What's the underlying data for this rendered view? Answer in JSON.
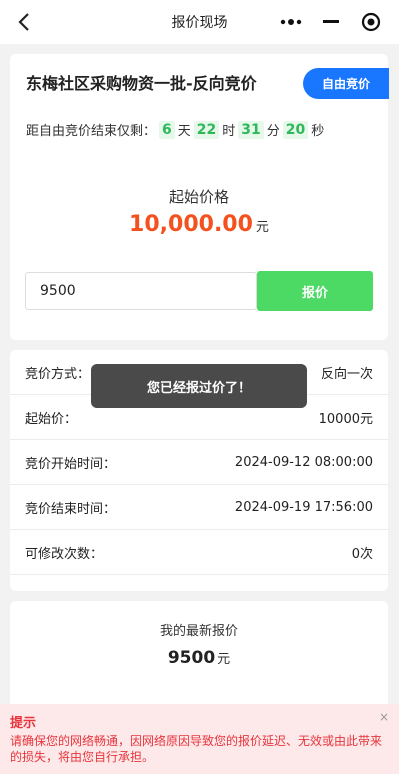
{
  "nav": {
    "title": "报价现场",
    "back_icon": "chevron-left-icon",
    "more_icon": "more-dots-icon",
    "minimize_icon": "minus-icon",
    "close_icon": "target-circle-icon"
  },
  "auction": {
    "title": "东梅社区采购物资一批-反向竞价",
    "tag": "自由竞价",
    "countdown_prefix": "距自由竞价结束仅剩：",
    "days": "6",
    "days_unit": "天",
    "hours": "22",
    "hours_unit": "时",
    "minutes": "31",
    "minutes_unit": "分",
    "seconds": "20",
    "seconds_unit": "秒",
    "start_price_label": "起始价格",
    "start_price_value": "10,000.00",
    "start_price_unit": "元",
    "bid_input_value": "9500",
    "bid_button": "报价"
  },
  "details": [
    {
      "label": "竞价方式：",
      "value": "反向一次"
    },
    {
      "label": "起始价：",
      "value": "10000元"
    },
    {
      "label": "竞价开始时间：",
      "value": "2024-09-12 08:00:00"
    },
    {
      "label": "竞价结束时间：",
      "value": "2024-09-19 17:56:00"
    },
    {
      "label": "可修改次数：",
      "value": "0次"
    }
  ],
  "mine": {
    "label": "我的最新报价",
    "value": "9500",
    "unit": "元"
  },
  "toast": "您已经报过价了！",
  "notice": {
    "title": "提示",
    "text": "请确保您的网络畅通，因网络原因导致您的报价延迟、无效或由此带来的损失，将由您自行承担。",
    "close": "×"
  },
  "colors": {
    "accent_blue": "#1976ff",
    "green": "#4cd964",
    "price_red": "#f4511e",
    "notice_red": "#e8343c"
  }
}
